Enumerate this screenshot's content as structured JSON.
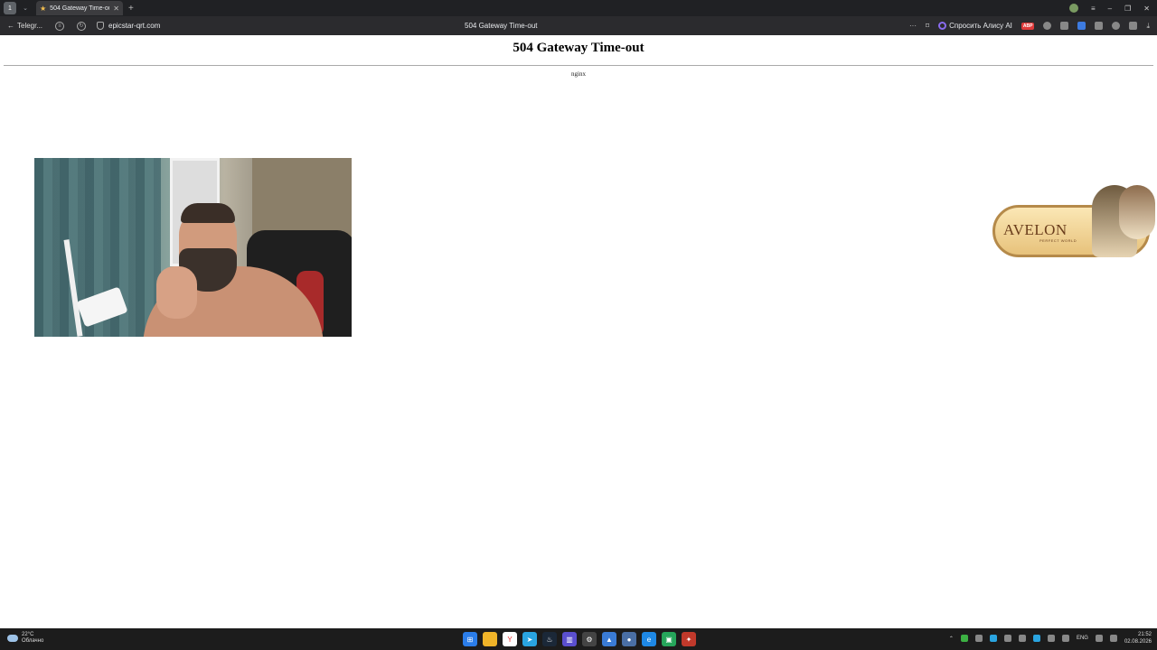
{
  "browser": {
    "tab": {
      "title": "504 Gateway Time-out"
    },
    "address_bar": {
      "back_label": "Telegr...",
      "url": "epicstar-qrt.com",
      "center_title": "504 Gateway Time-out",
      "alisa_label": "Спросить Алису AI",
      "abp_label": "ABP"
    }
  },
  "page": {
    "heading": "504 Gateway Time-out",
    "server": "nginx"
  },
  "ad_banner": {
    "logo_text": "AVELON",
    "subtitle": "PERFECT WORLD"
  },
  "taskbar": {
    "weather": {
      "temp": "22°C",
      "condition": "Облачно"
    },
    "language": "ENG",
    "clock": {
      "time": "21:52",
      "date": "02.08.2026"
    }
  },
  "colors": {
    "tabstrip_bg": "#202124",
    "addrbar_bg": "#2b2b2e",
    "taskbar_bg": "#1c1c1c",
    "alisa_accent": "#8a6cf0",
    "abp_red": "#e03b3b"
  },
  "icons": [
    "tab-switcher-icon",
    "star-icon",
    "close-icon",
    "new-tab-icon",
    "back-arrow-icon",
    "reload-icon",
    "shield-icon",
    "bookmark-icon",
    "menu-icon",
    "minimize-icon",
    "maximize-icon",
    "window-close-icon",
    "download-icon",
    "windows-start-icon",
    "file-explorer-icon",
    "telegram-icon",
    "steam-icon"
  ]
}
